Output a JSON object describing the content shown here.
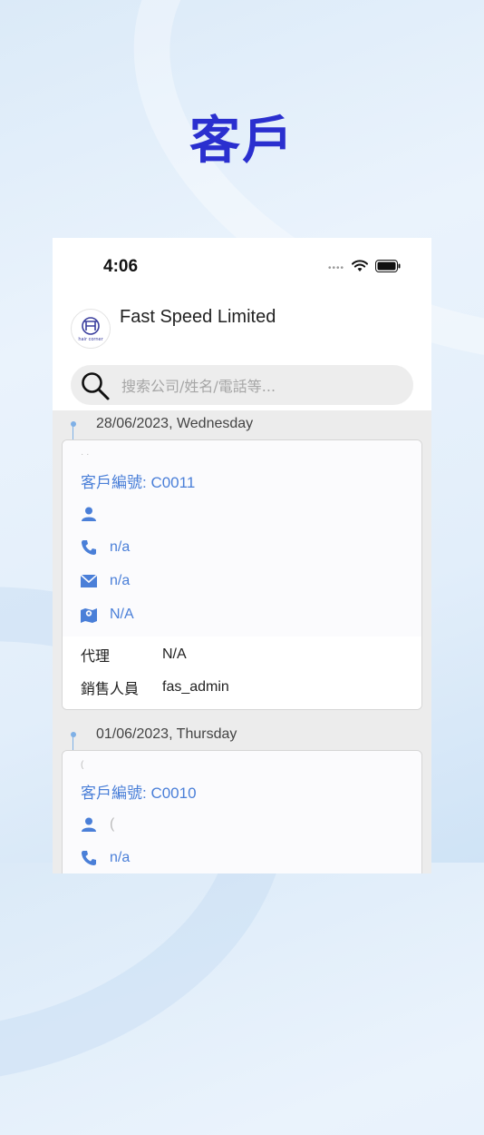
{
  "hero": {
    "title": "客戶"
  },
  "status_bar": {
    "time": "4:06"
  },
  "account": {
    "company": "Fast Speed Limited",
    "logo_text": "hair corner"
  },
  "search": {
    "placeholder": "搜索公司/姓名/電話等..."
  },
  "groups": [
    {
      "date": "28/06/2023, Wednesday",
      "card": {
        "name": "· ·",
        "customer_no": "客戶編號: C0011",
        "contact": "",
        "phone": "n/a",
        "email": "n/a",
        "address": "N/A",
        "agent_label": "代理",
        "agent": "N/A",
        "sales_label": "銷售人員",
        "sales": "fas_admin"
      }
    },
    {
      "date": "01/06/2023, Thursday",
      "card": {
        "name": "(",
        "customer_no": "客戶編號: C0010",
        "contact": "(",
        "phone": "n/a"
      }
    }
  ],
  "colors": {
    "accent": "#4a7fd8",
    "hero": "#2a2fcf"
  }
}
